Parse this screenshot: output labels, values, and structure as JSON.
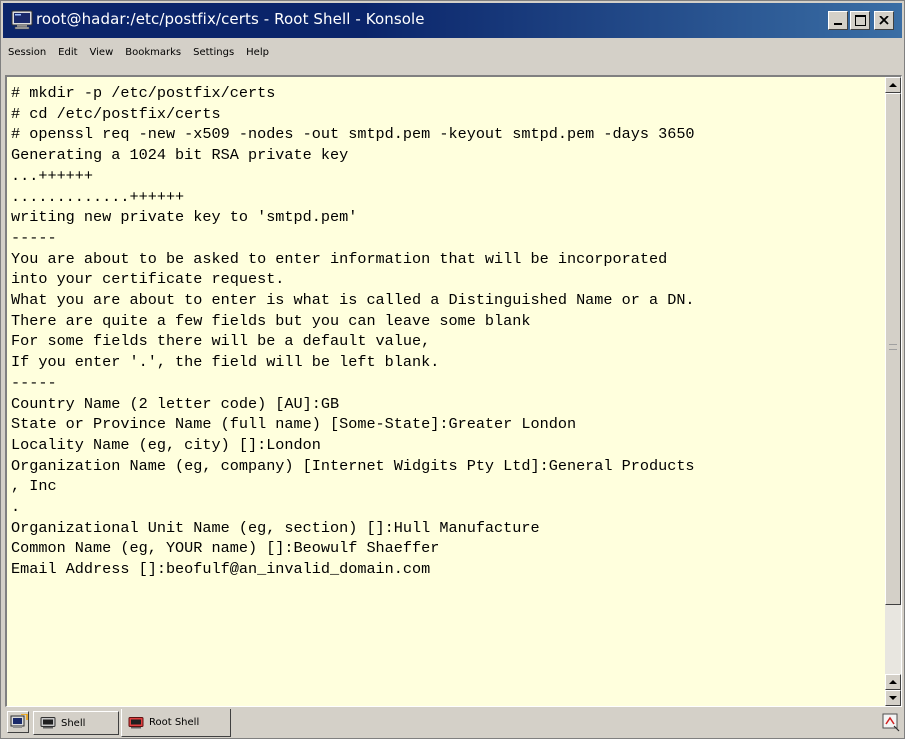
{
  "window": {
    "title": "root@hadar:/etc/postfix/certs - Root Shell - Konsole",
    "title_bg": "#0a246a"
  },
  "menubar": {
    "items": [
      {
        "label": "Session"
      },
      {
        "label": "Edit"
      },
      {
        "label": "View"
      },
      {
        "label": "Bookmarks"
      },
      {
        "label": "Settings"
      },
      {
        "label": "Help"
      }
    ]
  },
  "terminal": {
    "background": "#ffffdd",
    "lines": [
      "# mkdir -p /etc/postfix/certs",
      "# cd /etc/postfix/certs",
      "# openssl req -new -x509 -nodes -out smtpd.pem -keyout smtpd.pem -days 3650",
      "Generating a 1024 bit RSA private key",
      "...++++++",
      ".............++++++",
      "writing new private key to 'smtpd.pem'",
      "-----",
      "You are about to be asked to enter information that will be incorporated",
      "into your certificate request.",
      "What you are about to enter is what is called a Distinguished Name or a DN.",
      "There are quite a few fields but you can leave some blank",
      "For some fields there will be a default value,",
      "If you enter '.', the field will be left blank.",
      "-----",
      "Country Name (2 letter code) [AU]:GB",
      "State or Province Name (full name) [Some-State]:Greater London",
      "Locality Name (eg, city) []:London",
      "Organization Name (eg, company) [Internet Widgits Pty Ltd]:General Products",
      ", Inc",
      ".",
      "Organizational Unit Name (eg, section) []:Hull Manufacture",
      "Common Name (eg, YOUR name) []:Beowulf Shaeffer",
      "Email Address []:beofulf@an_invalid_domain.com"
    ]
  },
  "tabs": [
    {
      "label": "Shell",
      "icon": "terminal-icon"
    },
    {
      "label": "Root Shell",
      "icon": "root-terminal-icon"
    }
  ]
}
